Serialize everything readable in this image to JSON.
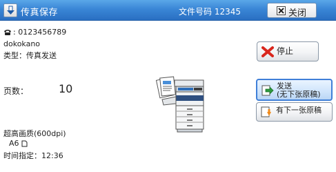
{
  "titlebar": {
    "title": "传真保存",
    "doc_number": "文件号码 12345",
    "close_label": "关闭"
  },
  "info": {
    "fax_number": "0123456789",
    "recipient": "dokokano",
    "type": "类型：传真发送",
    "pages_label": "页数：",
    "pages_value": "10",
    "quality": "超高画质(600dpi)",
    "paper_size": "A6",
    "time": "时间指定：12:36"
  },
  "buttons": {
    "stop": "停止",
    "send_line1": "发送",
    "send_line2": "(无下张原稿)",
    "next": "有下一张原稿"
  },
  "colors": {
    "title_bar": "#3a86d6",
    "send_highlight": "#3f7fd8",
    "stop_red": "#d9261c",
    "next_orange": "#f08a1a"
  },
  "icons": [
    "down-arrow-icon",
    "phone-icon",
    "close-icon",
    "stop-icon",
    "send-icon",
    "next-original-icon",
    "portrait-page-icon",
    "printer-illustration"
  ]
}
